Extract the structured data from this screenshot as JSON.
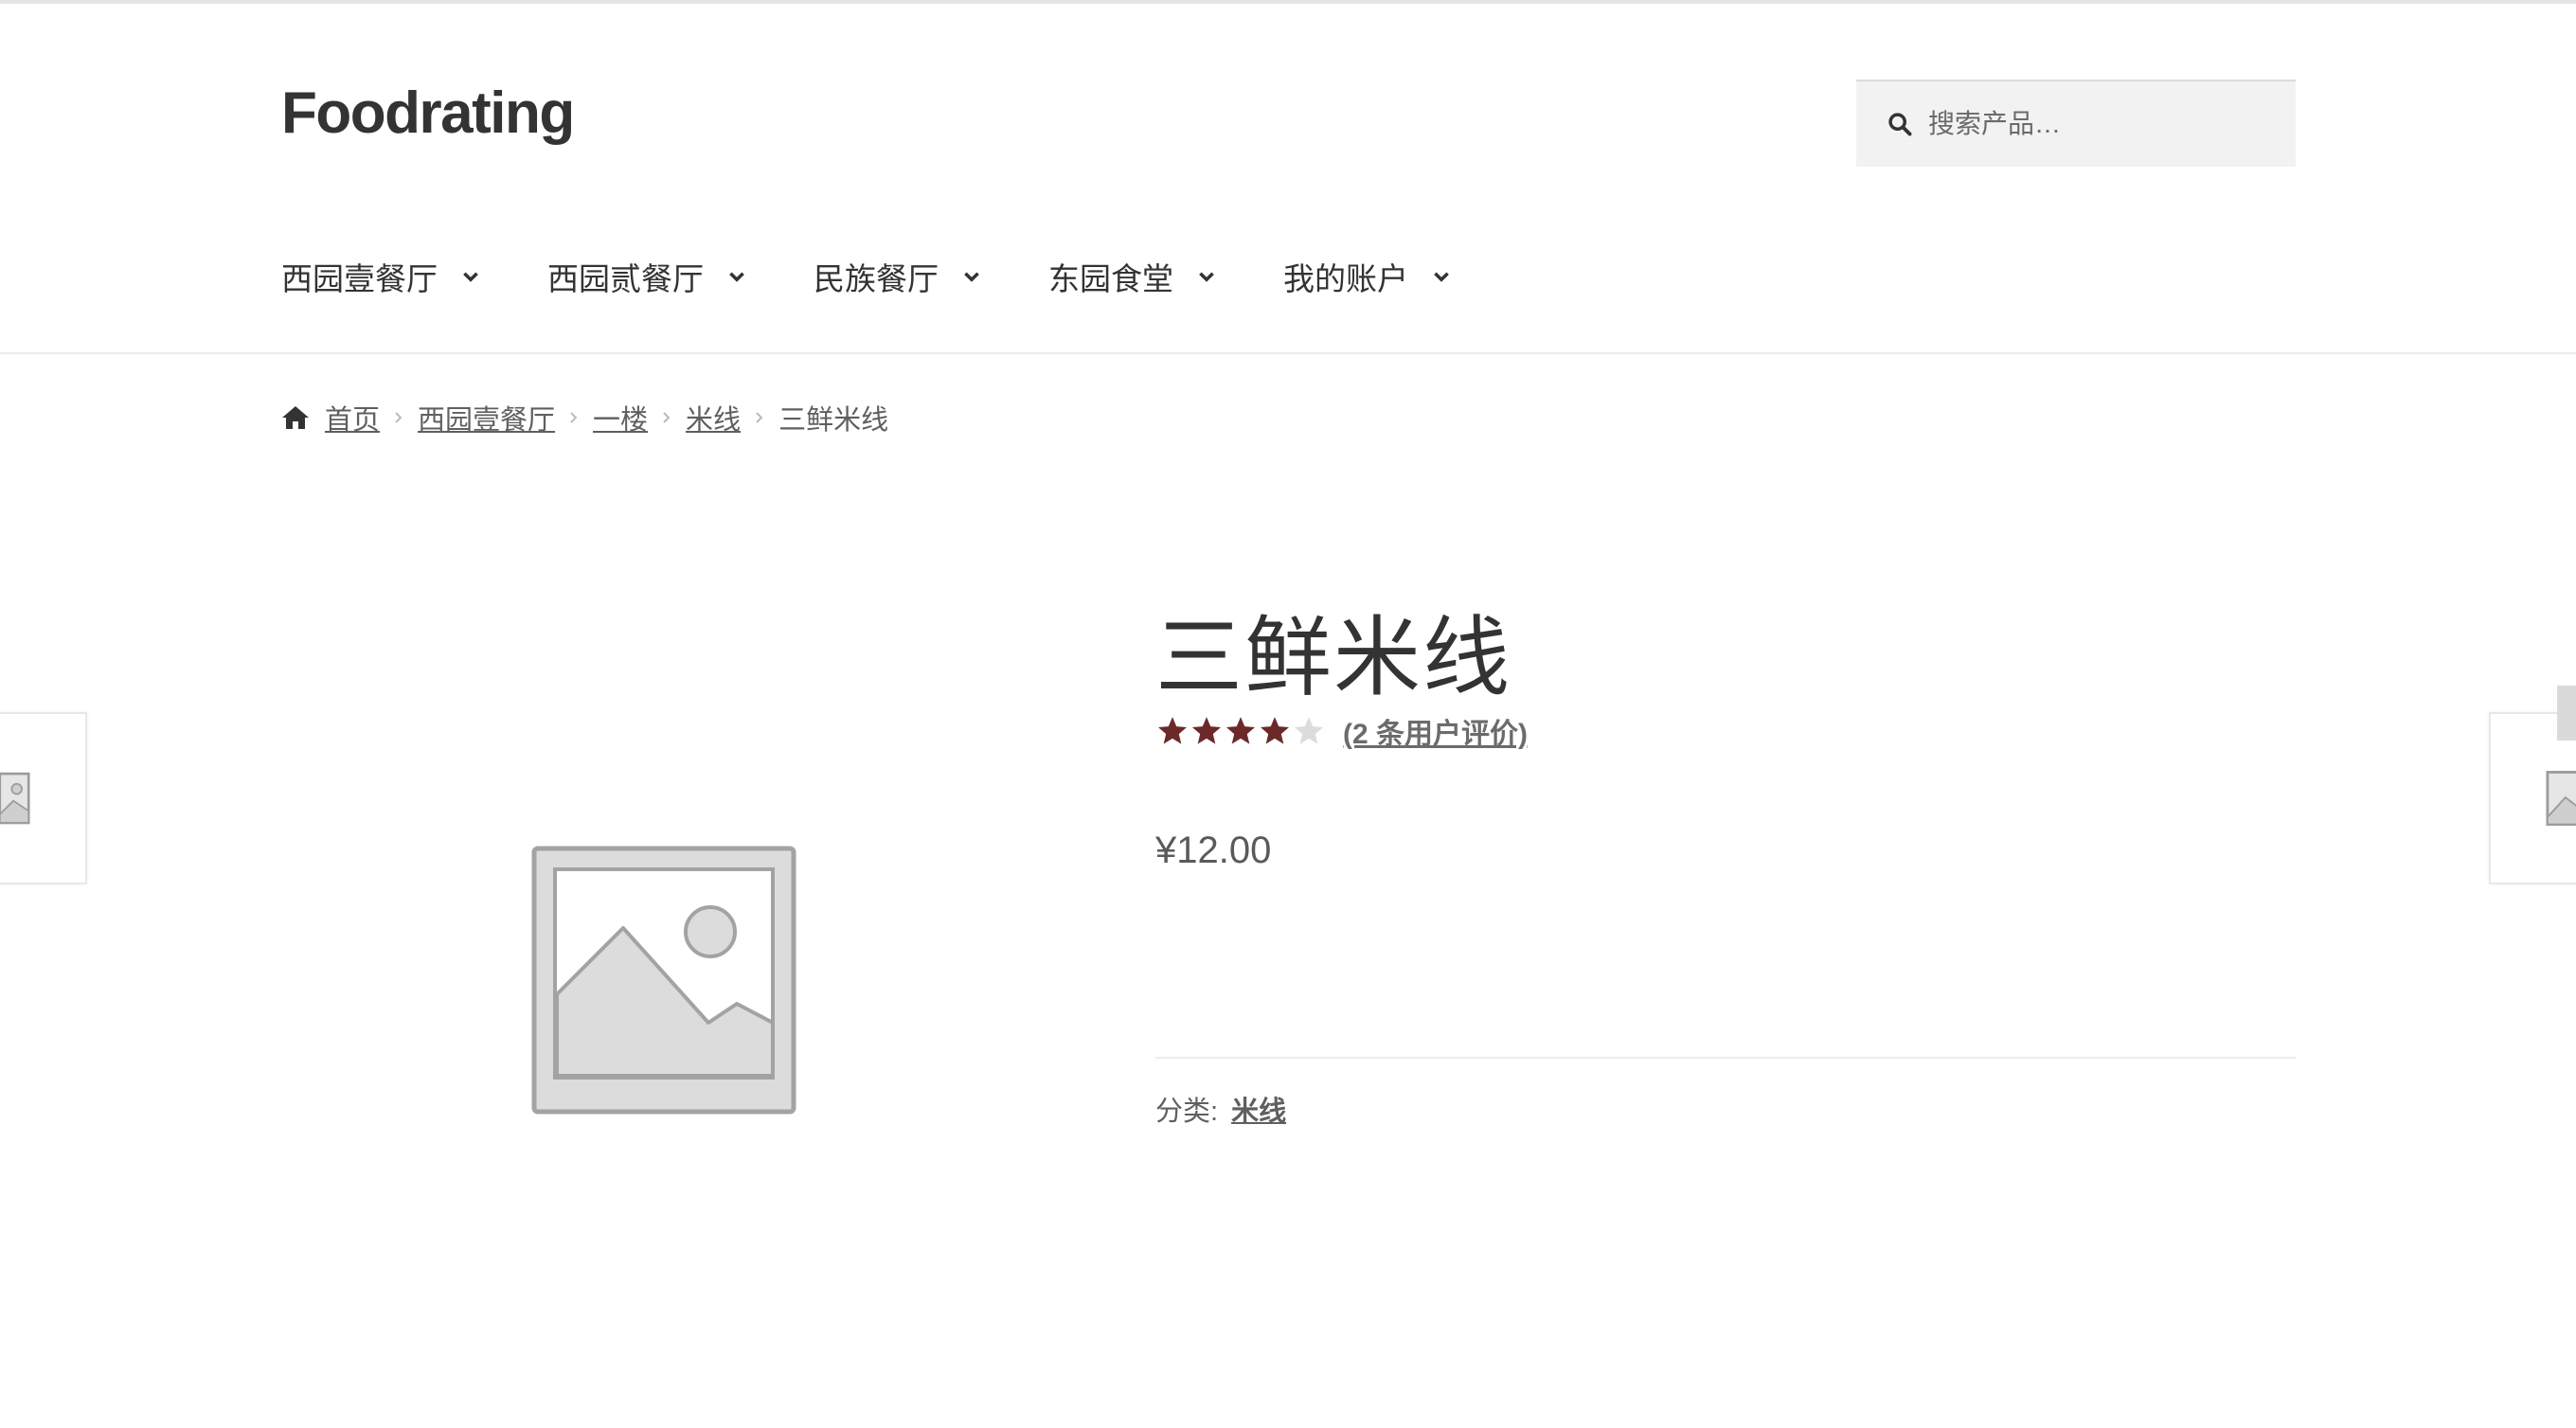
{
  "site": {
    "title": "Foodrating"
  },
  "search": {
    "placeholder": "搜索产品…",
    "icon": "search-icon"
  },
  "nav": {
    "items": [
      {
        "label": "西园壹餐厅"
      },
      {
        "label": "西园贰餐厅"
      },
      {
        "label": "民族餐厅"
      },
      {
        "label": "东园食堂"
      },
      {
        "label": "我的账户"
      }
    ]
  },
  "breadcrumb": {
    "items": [
      {
        "label": "首页",
        "link": true
      },
      {
        "label": "西园壹餐厅",
        "link": true
      },
      {
        "label": "一楼",
        "link": true
      },
      {
        "label": "米线",
        "link": true
      },
      {
        "label": "三鲜米线",
        "link": false
      }
    ]
  },
  "product": {
    "title": "三鲜米线",
    "rating_filled_stars": 4,
    "rating_max": 5,
    "review_link": "(2 条用户评价)",
    "price": "¥12.00",
    "category_label": "分类:",
    "category": "米线"
  },
  "colors": {
    "star_filled": "#6b2a2a",
    "star_empty": "#dcdcdc",
    "text": "#333333",
    "muted": "#5f5f5f"
  }
}
